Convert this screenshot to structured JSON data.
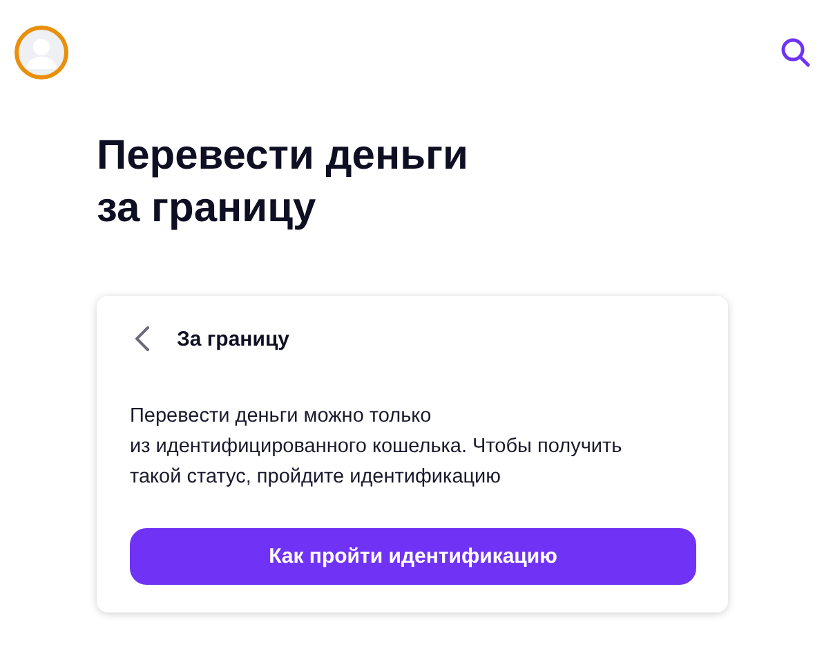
{
  "header": {
    "avatar": {
      "kind": "placeholder"
    }
  },
  "title": "Перевести деньги\nза границу",
  "card": {
    "heading": "За границу",
    "message": "Перевести деньги можно только\nиз идентифицированного кошелька. Чтобы получить\nтакой статус, пройдите идентификацию",
    "button": "Как пройти идентификацию"
  }
}
